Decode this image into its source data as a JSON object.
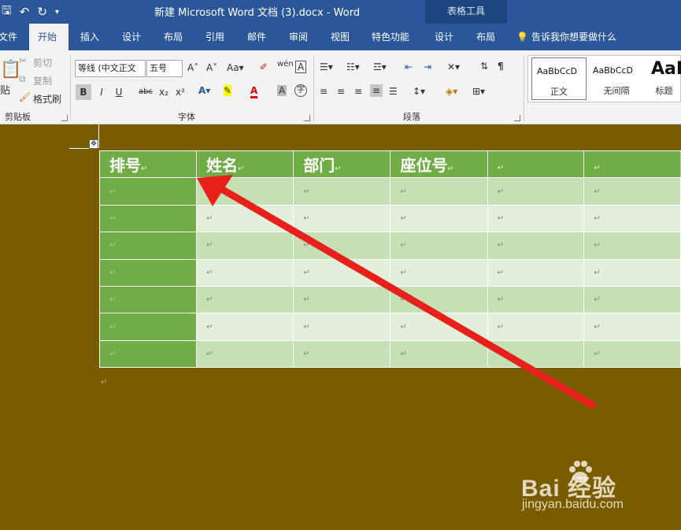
{
  "titlebar": {
    "doc_title": "新建 Microsoft Word 文档 (3).docx  -  Word",
    "context_title": "表格工具",
    "qat_icons": [
      "save-icon",
      "undo-icon",
      "redo-icon",
      "customize-icon"
    ]
  },
  "tabs": [
    {
      "label": "文件",
      "active": false
    },
    {
      "label": "开始",
      "active": true
    },
    {
      "label": "插入",
      "active": false
    },
    {
      "label": "设计",
      "active": false
    },
    {
      "label": "布局",
      "active": false
    },
    {
      "label": "引用",
      "active": false
    },
    {
      "label": "邮件",
      "active": false
    },
    {
      "label": "审阅",
      "active": false
    },
    {
      "label": "视图",
      "active": false
    },
    {
      "label": "特色功能",
      "active": false
    },
    {
      "label": "设计",
      "active": false
    },
    {
      "label": "布局",
      "active": false
    }
  ],
  "tellme": "告诉我你想要做什么",
  "clipboard": {
    "paste": "贴",
    "cut": "剪切",
    "copy": "复制",
    "format_painter": "格式刷",
    "label": "剪贴板"
  },
  "font": {
    "font_name": "等线 (中文正文",
    "font_size": "五号",
    "label": "字体",
    "buttons": [
      "B",
      "I",
      "U",
      "abc",
      "x₂",
      "x²"
    ]
  },
  "paragraph": {
    "label": "段落"
  },
  "styles": [
    {
      "sample": "AaBbCcD",
      "name": "正文"
    },
    {
      "sample": "AaBbCcD",
      "name": "无间隔"
    },
    {
      "sample": "AaB",
      "name": "标题"
    }
  ],
  "table": {
    "headers": [
      "排号",
      "姓名",
      "部门",
      "座位号",
      "",
      ""
    ],
    "row_count": 7,
    "cell_mark": "↵"
  },
  "watermark": {
    "brand": "Bai 经验",
    "url": "jingyan.baidu.com"
  },
  "colors": {
    "title_bar": "#2b579a",
    "ribbon": "#f3f3f3",
    "page_bg": "#7a5c00",
    "table_header": "#70ad47",
    "table_band_odd": "#c5e0b4",
    "table_band_even": "#e2efda",
    "arrow": "#e8201c"
  }
}
